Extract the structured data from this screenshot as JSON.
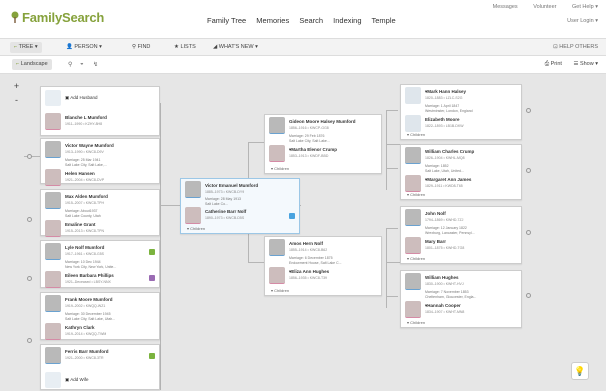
{
  "header": {
    "logo": "FamilySearch",
    "nav": [
      "Family Tree",
      "Memories",
      "Search",
      "Indexing",
      "Temple"
    ],
    "util": [
      "Messages",
      "Volunteer",
      "Get Help ▾"
    ],
    "user": "User Login ▾"
  },
  "toolbar": {
    "tree": "TREE ▾",
    "person": "PERSON ▾",
    "find": "FIND",
    "lists": "LISTS",
    "whatsnew": "WHAT'S NEW ▾",
    "helpothers": "HELP OTHERS"
  },
  "viewbar": {
    "landscape": "Landscape",
    "print": "Print",
    "show": "Show ▾"
  },
  "zoom": {
    "in": "+",
    "out": "-"
  },
  "children_label": "Children",
  "add_husband": "Add Husband",
  "add_wife": "Add Wife",
  "people": {
    "blanche": {
      "name": "Blanche L Mumford",
      "dates": "1911–1990 • KZHY-8H8"
    },
    "victor_w": {
      "name": "Victor Wayne Mumford",
      "dates": "1913–1990 • KWC8-D9V"
    },
    "victor_w_marriage": [
      "Marriage: 25 Mar 1941",
      "Salt Lake City, Salt Lake,..."
    ],
    "helen": {
      "name": "Helen Hansen",
      "dates": "1921–2004 • KWC8-DVP"
    },
    "max": {
      "name": "Max Alden Mumford",
      "dates": "1915–2007 • KWC8-TPH"
    },
    "max_marriage": [
      "Marriage: About1937",
      "Salt Lake County, Utah"
    ],
    "emaline": {
      "name": "Emaline Grant",
      "dates": "1915–2013 • KWC8-TPN"
    },
    "lyle": {
      "name": "Lyle Nolf Mumford",
      "dates": "1917–1961 • KWC8-G5S"
    },
    "lyle_marriage": [
      "Marriage: 10 Dec 1944",
      "New York City, New York, Unite..."
    ],
    "eileen": {
      "name": "Eileen Barbara Phillips",
      "dates": "1921–Deceased • LBSY-NNX"
    },
    "frank": {
      "name": "Frank Moore Mumford",
      "dates": "1919–2002 • KWQQ-WZ1"
    },
    "frank_marriage": [
      "Marriage: 30 December 1945",
      "Salt Lake City, Salt Lake, Utah..."
    ],
    "kathryn": {
      "name": "Kathryn Clark",
      "dates": "1919–2014 • KWQQ-TWM"
    },
    "ferris": {
      "name": "Ferris Barr Mumford",
      "dates": "1921–2000 • KWC8-3TR"
    },
    "victor_e": {
      "name": "Victor Emanuel Mumford",
      "dates": "1885–1973 • KWCB-DY9"
    },
    "victor_e_marriage": [
      "Marriage: 28 May 1913",
      "Salt Lake Co..."
    ],
    "catherine": {
      "name": "Catherine Barr Nolf",
      "dates": "1890–1973 • KWCB-D5S"
    },
    "gideon": {
      "name": "Gideon Moore Halsey Mumford",
      "dates": "1856–1916 • KWCP-GG8"
    },
    "gideon_marriage": [
      "Marriage: 29 Feb 1876",
      "Salt Lake City, Salt Lake..."
    ],
    "martha": {
      "name": "Martha Elenor Crump",
      "dates": "1853–1913 • KWDF-BBD"
    },
    "amos": {
      "name": "Amos Hern Nolf",
      "dates": "1855–1914 • KWC8-B62"
    },
    "amos_marriage": [
      "Marriage: 6 December 1875",
      "Endowment House, Salt Lake C..."
    ],
    "eliza": {
      "name": "Eliza Ann Hughes",
      "dates": "1856–1935 • KWC8-T39"
    },
    "mark": {
      "name": "Mark Hann Halsey",
      "dates": "1820–1883 • LZLC-S2G"
    },
    "mark_marriage": [
      "Marriage: 1 April 1847",
      "Westminster, London, England"
    ],
    "elizabeth": {
      "name": "Elizabeth Moore",
      "dates": "1822–1893 • LB1B-DKW"
    },
    "william_c": {
      "name": "William Charles Crump",
      "dates": "1826–1904 • KWHL-MQ8"
    },
    "william_c_marriage": [
      "Marriage: 1852",
      "Salt Lake, Utah, United..."
    ],
    "margaret": {
      "name": "Margaret Ann James",
      "dates": "1829–1911 • KWD8-T65"
    },
    "john": {
      "name": "John Nolf",
      "dates": "1794–1869 • KWHD-7ZJ"
    },
    "john_marriage": [
      "Marriage: 12 January 1822",
      "Wrexburg, Lancaster, Pennsyl..."
    ],
    "mary": {
      "name": "Mary Barr",
      "dates": "1801–1875 • KWHD-TG8"
    },
    "william_h": {
      "name": "William Hughes",
      "dates": "1830–1900 • KWHT-HVJ"
    },
    "william_h_marriage": [
      "Marriage: 7 November 1853",
      "Cheltenham, Gloucester, Engla..."
    ],
    "hannah": {
      "name": "Hannah Cooper",
      "dates": "1834–1907 • KWHT-MN8"
    }
  }
}
